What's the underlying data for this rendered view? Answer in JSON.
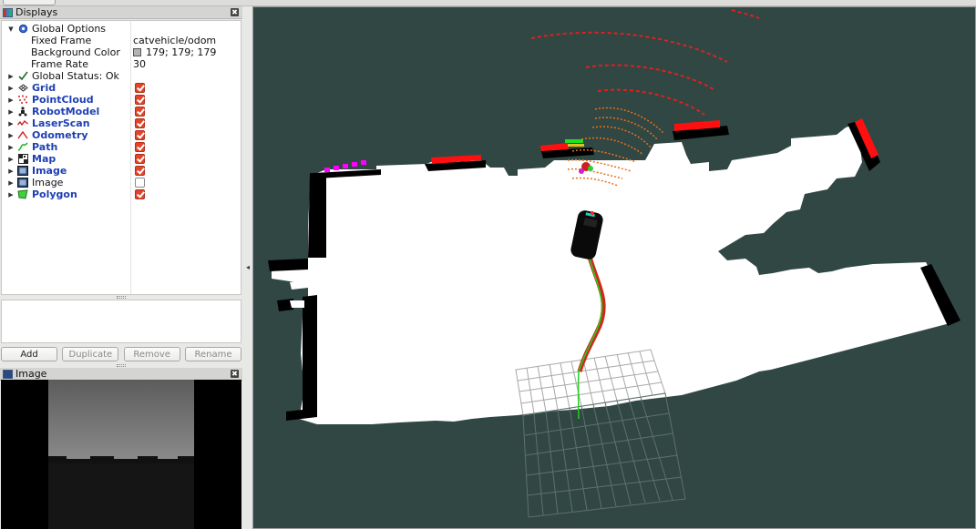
{
  "displays_panel": {
    "title": "Displays",
    "close_glyph": "✖",
    "global_options": {
      "label": "Global Options",
      "fixed_frame": {
        "label": "Fixed Frame",
        "value": "catvehicle/odom"
      },
      "background_color": {
        "label": "Background Color",
        "value": "179; 179; 179",
        "swatch": "#b3b3b3"
      },
      "frame_rate": {
        "label": "Frame Rate",
        "value": "30"
      }
    },
    "global_status": {
      "label": "Global Status: Ok"
    },
    "items": [
      {
        "label": "Grid",
        "icon": "grid-icon",
        "enabled": true
      },
      {
        "label": "PointCloud",
        "icon": "pointcloud-icon",
        "enabled": true
      },
      {
        "label": "RobotModel",
        "icon": "robotmodel-icon",
        "enabled": true
      },
      {
        "label": "LaserScan",
        "icon": "laserscan-icon",
        "enabled": true
      },
      {
        "label": "Odometry",
        "icon": "odometry-icon",
        "enabled": true
      },
      {
        "label": "Path",
        "icon": "path-icon",
        "enabled": true
      },
      {
        "label": "Map",
        "icon": "map-icon",
        "enabled": true
      },
      {
        "label": "Image",
        "icon": "image-icon",
        "enabled": true
      },
      {
        "label": "Image",
        "icon": "image-icon",
        "enabled": false
      },
      {
        "label": "Polygon",
        "icon": "polygon-icon",
        "enabled": true
      }
    ]
  },
  "buttons": {
    "add": "Add",
    "duplicate": "Duplicate",
    "remove": "Remove",
    "rename": "Rename"
  },
  "image_panel": {
    "title": "Image",
    "close_glyph": "✖"
  },
  "viewport": {
    "background_color": "#304743",
    "map_free_color": "#ffffff",
    "map_occupied_color": "#000000",
    "laser_color": "#ff1010",
    "pointcloud_color": "#e8701a",
    "path_color": "#cc2a1a",
    "odometry_path_color": "#20d020",
    "grid_color": "#a0a0a0"
  },
  "colors": {
    "checkbox_on": "#e0452a",
    "link_blue": "#1e3fb4"
  }
}
